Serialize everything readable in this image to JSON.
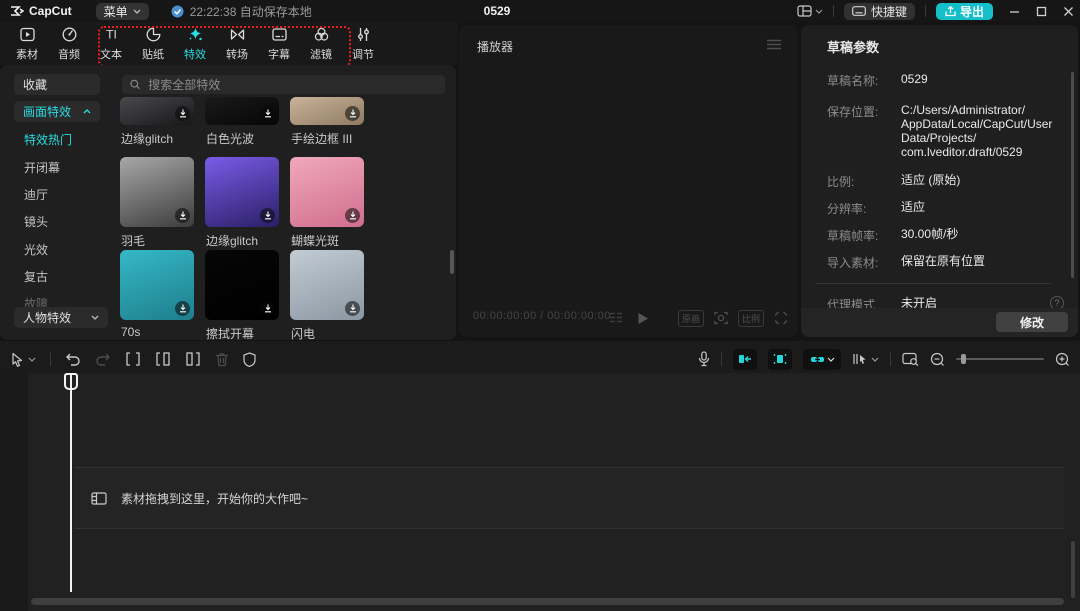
{
  "colors": {
    "accent_cyan": "#2adde2",
    "export_button": "#14bfc9",
    "annotation_red": "#ef1f1f",
    "save_check_blue": "#4a8fd0"
  },
  "titlebar": {
    "app_name": "CapCut",
    "menu_label": "菜单",
    "autosave_status": "22:22:38 自动保存本地",
    "doc_title": "0529",
    "shortcut_label": "快捷键",
    "export_label": "导出"
  },
  "tabs": [
    {
      "label": "素材",
      "active": false
    },
    {
      "label": "音频",
      "active": false
    },
    {
      "label": "文本",
      "active": false
    },
    {
      "label": "贴纸",
      "active": false
    },
    {
      "label": "特效",
      "active": true
    },
    {
      "label": "转场",
      "active": false
    },
    {
      "label": "字幕",
      "active": false
    },
    {
      "label": "滤镜",
      "active": false
    },
    {
      "label": "调节",
      "active": false
    }
  ],
  "icons": {
    "text_tab_glyph": "TI",
    "help_glyph": "?"
  },
  "sidebar": {
    "favorites": "收藏",
    "group": "画面特效",
    "categories": [
      {
        "label": "特效热门",
        "active": true
      },
      {
        "label": "开闭幕",
        "active": false
      },
      {
        "label": "迪厅",
        "active": false
      },
      {
        "label": "镜头",
        "active": false
      },
      {
        "label": "光效",
        "active": false
      },
      {
        "label": "复古",
        "active": false
      },
      {
        "label": "故障",
        "active": false
      }
    ],
    "bottom_group": "人物特效"
  },
  "search": {
    "placeholder": "搜索全部特效"
  },
  "effects": {
    "items": [
      {
        "name": "边缘glitch",
        "c1": "#4a4a4e",
        "c2": "#17171a"
      },
      {
        "name": "白色光波",
        "c1": "#1a1a1a",
        "c2": "#060606"
      },
      {
        "name": "手绘边框 III",
        "c1": "#c9b49a",
        "c2": "#8e7a62"
      },
      {
        "name": "羽毛",
        "c1": "#a8a8a8",
        "c2": "#3c3c3e"
      },
      {
        "name": "边缘glitch",
        "c1": "#7a5ce8",
        "c2": "#2a1f66"
      },
      {
        "name": "蝴蝶光斑",
        "c1": "#f0a8bc",
        "c2": "#d06e8e"
      },
      {
        "name": "70s",
        "c1": "#35b8c6",
        "c2": "#1f7e8c"
      },
      {
        "name": "擦拭开幕",
        "c1": "#060606",
        "c2": "#000000"
      },
      {
        "name": "闪电",
        "c1": "#c3ccd4",
        "c2": "#8a97a2"
      }
    ]
  },
  "player": {
    "title": "播放器",
    "timecode": "00:00:00:00 / 00:00:00:00",
    "quality_label": "原画",
    "ratio_label": "比例"
  },
  "params": {
    "title": "草稿参数",
    "rows": [
      {
        "label": "草稿名称:",
        "value": "0529"
      },
      {
        "label": "保存位置:",
        "value": "C:/Users/Administrator/\nAppData/Local/CapCut/User\nData/Projects/\ncom.lveditor.draft/0529"
      },
      {
        "label": "比例:",
        "value": "适应 (原始)"
      },
      {
        "label": "分辨率:",
        "value": "适应"
      },
      {
        "label": "草稿帧率:",
        "value": "30.00帧/秒"
      },
      {
        "label": "导入素材:",
        "value": "保留在原有位置"
      }
    ],
    "proxy_label": "代理模式",
    "proxy_value": "未开启",
    "modify_label": "修改"
  },
  "timeline": {
    "empty_text": "素材拖拽到这里，开始你的大作吧~"
  }
}
